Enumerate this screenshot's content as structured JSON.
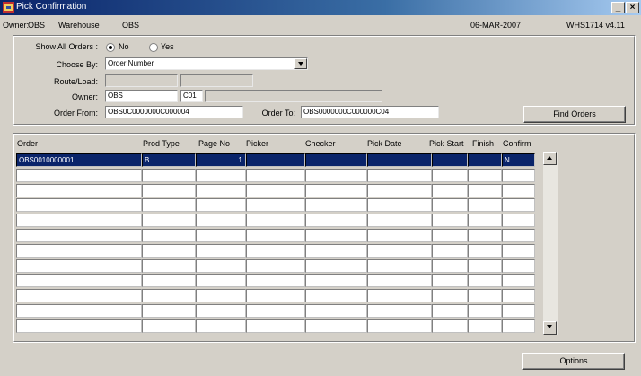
{
  "window": {
    "title": "Pick Confirmation",
    "minimize": "_",
    "close": "×"
  },
  "header": {
    "owner_label": "Owner:",
    "owner_value": "OBS",
    "warehouse_label": "Warehouse",
    "warehouse_value": "OBS",
    "date": "06-MAR-2007",
    "version": "WHS1714  v4.11"
  },
  "filters": {
    "show_all_label": "Show All Orders :",
    "show_all_no": "No",
    "show_all_yes": "Yes",
    "show_all_selected": "No",
    "choose_by_label": "Choose By:",
    "choose_by_value": "Order Number",
    "route_load_label": "Route/Load:",
    "route_value": "",
    "load_value": "",
    "owner_label": "Owner:",
    "owner_code": "OBS",
    "owner_sub": "C01",
    "owner_desc": "",
    "order_from_label": "Order From:",
    "order_from_value": "OBS0C0000000C000004",
    "order_to_label": "Order To:",
    "order_to_value": "OBS0000000C000000C04",
    "find_orders_label": "Find Orders"
  },
  "grid": {
    "columns": [
      "Order",
      "Prod Type",
      "Page No",
      "Picker",
      "Checker",
      "Pick Date",
      "Pick Start",
      "Finish",
      "Confirm"
    ],
    "rows": [
      [
        "OBS0010000001",
        "B",
        "1",
        "",
        "",
        "",
        "",
        "",
        "N"
      ],
      [
        "",
        "",
        "",
        "",
        "",
        "",
        "",
        "",
        ""
      ],
      [
        "",
        "",
        "",
        "",
        "",
        "",
        "",
        "",
        ""
      ],
      [
        "",
        "",
        "",
        "",
        "",
        "",
        "",
        "",
        ""
      ],
      [
        "",
        "",
        "",
        "",
        "",
        "",
        "",
        "",
        ""
      ],
      [
        "",
        "",
        "",
        "",
        "",
        "",
        "",
        "",
        ""
      ],
      [
        "",
        "",
        "",
        "",
        "",
        "",
        "",
        "",
        ""
      ],
      [
        "",
        "",
        "",
        "",
        "",
        "",
        "",
        "",
        ""
      ],
      [
        "",
        "",
        "",
        "",
        "",
        "",
        "",
        "",
        ""
      ],
      [
        "",
        "",
        "",
        "",
        "",
        "",
        "",
        "",
        ""
      ],
      [
        "",
        "",
        "",
        "",
        "",
        "",
        "",
        "",
        ""
      ],
      [
        "",
        "",
        "",
        "",
        "",
        "",
        "",
        "",
        ""
      ]
    ]
  },
  "footer": {
    "options_label": "Options"
  }
}
